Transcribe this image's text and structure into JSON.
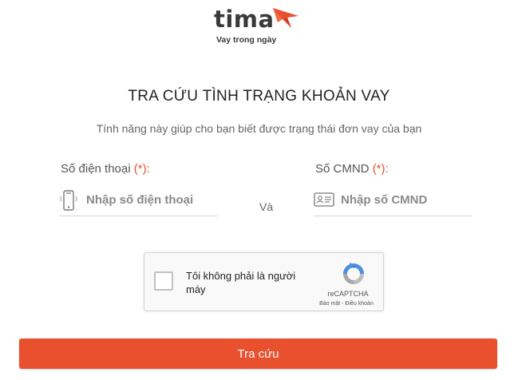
{
  "brand": {
    "name": "tima",
    "tagline": "Vay trong ngày",
    "accent_color": "#e8502e"
  },
  "page": {
    "title": "TRA CỨU TÌNH TRẠNG KHOẢN VAY",
    "subtitle": "Tính năng này giúp cho bạn biết được trạng thái đơn vay của bạn"
  },
  "form": {
    "phone": {
      "label": "Số điện thoại",
      "required_mark": "(*):",
      "placeholder": "Nhập số điện thoại",
      "value": "",
      "icon": "mobile-phone-icon"
    },
    "conjunction": "Và",
    "id_card": {
      "label": "Số CMND",
      "required_mark": "(*):",
      "placeholder": "Nhập số CMND",
      "value": "",
      "icon": "id-card-icon"
    }
  },
  "captcha": {
    "label": "Tôi không phải là người máy",
    "brand": "reCAPTCHA",
    "links": "Bảo mật - Điều khoản",
    "checked": false
  },
  "submit": {
    "label": "Tra cứu"
  }
}
